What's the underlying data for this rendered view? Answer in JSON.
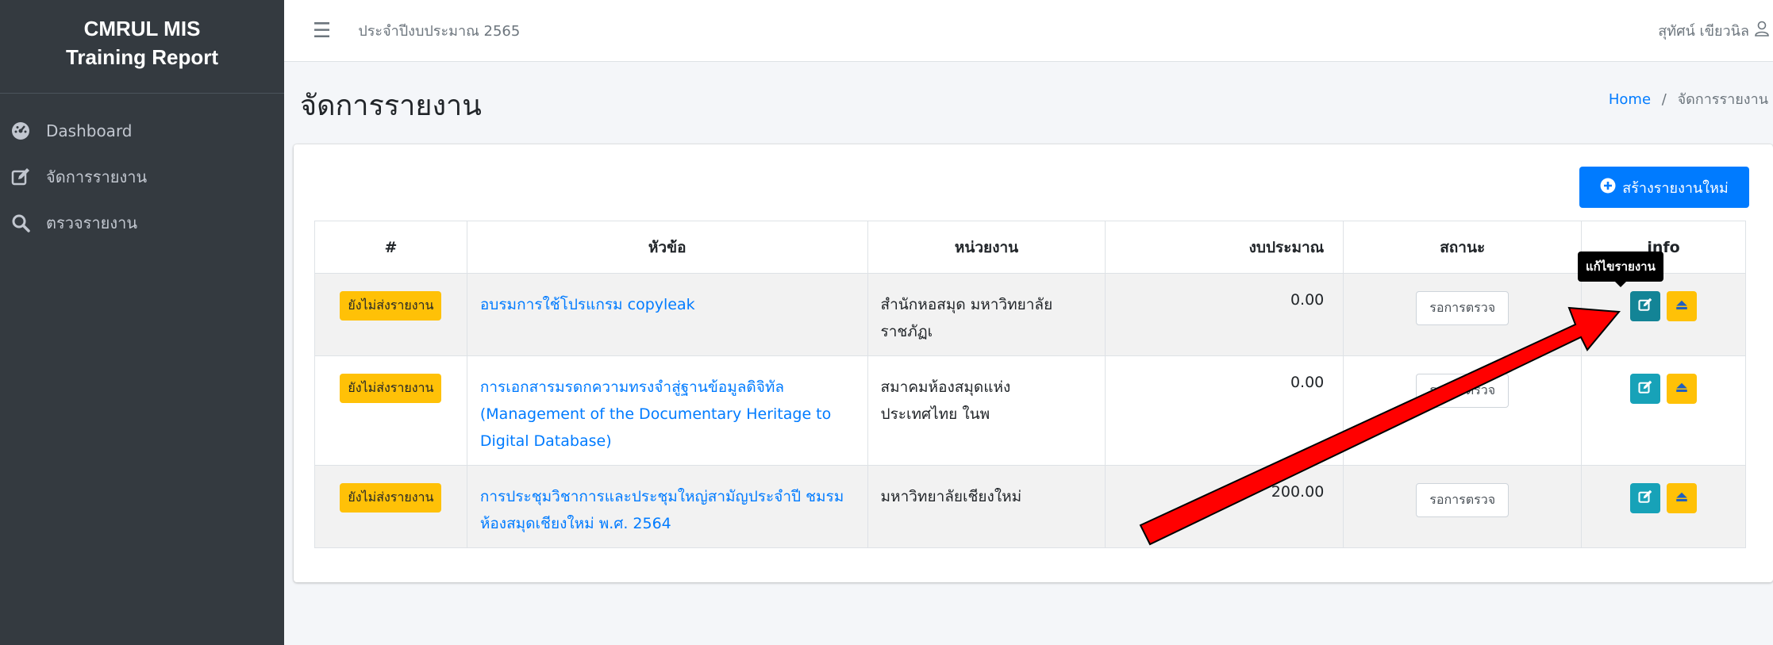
{
  "sidebar": {
    "brand_line1": "CMRUL MIS",
    "brand_line2": "Training Report",
    "items": [
      {
        "label": "Dashboard",
        "icon": "tachometer-icon"
      },
      {
        "label": "จัดการรายงาน",
        "icon": "edit-icon"
      },
      {
        "label": "ตรวจรายงาน",
        "icon": "search-icon"
      }
    ]
  },
  "topbar": {
    "fiscal_year": "ประจำปีงบประมาณ 2565",
    "user_name": "สุทัศน์ เขียวนิล"
  },
  "page": {
    "title": "จัดการรายงาน",
    "breadcrumb_home": "Home",
    "breadcrumb_sep": "/",
    "breadcrumb_current": "จัดการรายงาน"
  },
  "actions": {
    "create_label": "สร้างรายงานใหม่",
    "tooltip": "แก้ไขรายงาน"
  },
  "table": {
    "headers": [
      "#",
      "หัวข้อ",
      "หน่วยงาน",
      "งบประมาณ",
      "สถานะ",
      "info"
    ],
    "rows": [
      {
        "badge": "ยังไม่ส่งรายงาน",
        "topic": "อบรมการใช้โปรแกรม copyleak",
        "dept": "สำนักหอสมุด มหาวิทยาลัยราชภัฏเ",
        "budget": "0.00",
        "status": "รอการตรวจ"
      },
      {
        "badge": "ยังไม่ส่งรายงาน",
        "topic": "การเอกสารมรดกความทรงจำสู่ฐานข้อมูลดิจิทัล (Management of the Documentary Heritage to Digital Database)",
        "dept": "สมาคมห้องสมุดแห่งประเทศไทย ในพ",
        "budget": "0.00",
        "status": "รอการตรวจ"
      },
      {
        "badge": "ยังไม่ส่งรายงาน",
        "topic": "การประชุมวิชาการและประชุมใหญ่สามัญประจำปี ชมรมห้องสมุดเชียงใหม่ พ.ศ. 2564",
        "dept": "มหาวิทยาลัยเชียงใหม่",
        "budget": "200.00",
        "status": "รอการตรวจ"
      }
    ]
  },
  "colors": {
    "sidebar_bg": "#343a40",
    "primary": "#007bff",
    "warning": "#ffc107",
    "info": "#17a2b8",
    "annotation_arrow": "#ff0000"
  }
}
